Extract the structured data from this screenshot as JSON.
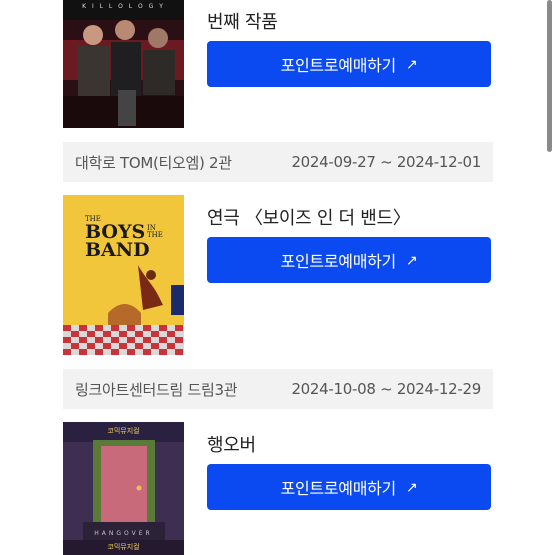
{
  "items": [
    {
      "title": "번째 작품",
      "button_label": "포인트로예매하기",
      "arrow": "↗",
      "poster": {
        "text": "K I L L O L O G Y",
        "bg": "#3a1418"
      }
    },
    {
      "venue": "대학로 TOM(티오엠) 2관",
      "dates": "2024-09-27 ~ 2024-12-01",
      "title": "연극 〈보이즈 인 더 밴드〉",
      "button_label": "포인트로예매하기",
      "arrow": "↗",
      "poster": {
        "line1": "BOYS",
        "line2": "BAND",
        "small_the": "THE",
        "small_in": "IN THE",
        "bg": "#f2c63a"
      }
    },
    {
      "venue": "링크아트센터드림 드림3관",
      "dates": "2024-10-08 ~ 2024-12-29",
      "title": "행오버",
      "button_label": "포인트로예매하기",
      "arrow": "↗",
      "poster": {
        "top_text": "코믹뮤지컬",
        "bottom_text": "코믹뮤지컬",
        "caption": "HANGOVER",
        "bg": "#3e2f52"
      }
    }
  ],
  "colors": {
    "accent": "#0a4af0",
    "venue_bg": "#f2f2f2"
  }
}
